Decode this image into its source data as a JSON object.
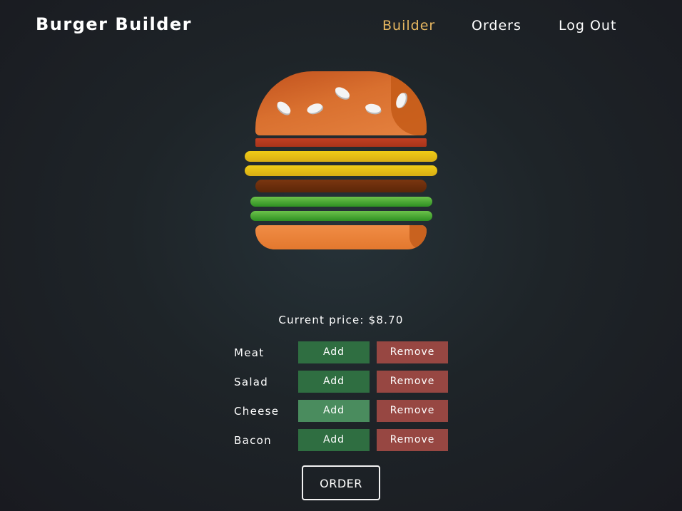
{
  "header": {
    "logo": "Burger Builder",
    "nav": [
      {
        "label": "Builder",
        "active": true
      },
      {
        "label": "Orders",
        "active": false
      },
      {
        "label": "Log Out",
        "active": false
      }
    ]
  },
  "burger": {
    "layers_top_to_bottom": [
      "bread-top",
      "meat",
      "cheese",
      "cheese",
      "bacon",
      "salad",
      "salad",
      "bread-bottom"
    ]
  },
  "price": {
    "text": "Current price: $8.70"
  },
  "controls": [
    {
      "label": "Meat",
      "add": "Add",
      "remove": "Remove"
    },
    {
      "label": "Salad",
      "add": "Add",
      "remove": "Remove"
    },
    {
      "label": "Cheese",
      "add": "Add",
      "remove": "Remove"
    },
    {
      "label": "Bacon",
      "add": "Add",
      "remove": "Remove"
    }
  ],
  "order": {
    "label": "ORDER"
  },
  "colors": {
    "accent_active_nav": "#e8b861",
    "add_button": "#2f6e41",
    "add_button_hover": "#4a8c5e",
    "remove_button": "#974742",
    "background": "#1e2428"
  }
}
